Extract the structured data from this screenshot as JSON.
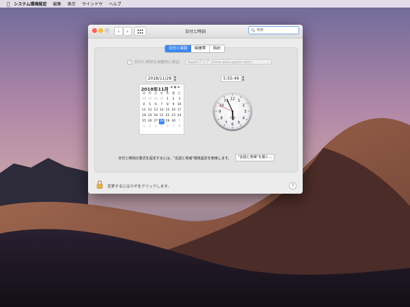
{
  "menubar": {
    "apple_icon": "apple-logo-icon",
    "app_name": "システム環境設定",
    "items": [
      "編集",
      "表示",
      "ウインドウ",
      "ヘルプ"
    ]
  },
  "window": {
    "title": "日付と時刻",
    "search_placeholder": "検索",
    "nav_back": "‹",
    "nav_forward": "›",
    "grid_icon": "grid-icon"
  },
  "tabs": [
    {
      "label": "日付と時刻",
      "active": true
    },
    {
      "label": "時間帯",
      "active": false
    },
    {
      "label": "時計",
      "active": false
    }
  ],
  "auto": {
    "label": "日付と時刻を自動的に設定:",
    "checked": true,
    "server": "Appleアジア (time.asia.apple.com)"
  },
  "date_field": "2018/11/28",
  "time_field": "5:55:49",
  "calendar": {
    "month": "2018年11月",
    "nav": [
      "◀",
      "●",
      "▶"
    ],
    "weekdays": [
      "日",
      "月",
      "火",
      "水",
      "木",
      "金",
      "土"
    ],
    "weeks": [
      [
        "28",
        "29",
        "30",
        "31",
        "1",
        "2",
        "3"
      ],
      [
        "4",
        "5",
        "6",
        "7",
        "8",
        "9",
        "10"
      ],
      [
        "11",
        "12",
        "13",
        "14",
        "15",
        "16",
        "17"
      ],
      [
        "18",
        "19",
        "20",
        "21",
        "22",
        "23",
        "24"
      ],
      [
        "25",
        "26",
        "27",
        "28",
        "29",
        "30",
        "1"
      ],
      [
        "2",
        "3",
        "4",
        "5",
        "6",
        "7",
        "8"
      ]
    ],
    "selected": "28"
  },
  "clock": {
    "numbers": [
      "12",
      "1",
      "2",
      "3",
      "4",
      "5",
      "6",
      "7",
      "8",
      "9",
      "10",
      "11"
    ],
    "ampm": "午前",
    "hour": 5,
    "minute": 55,
    "second": 49
  },
  "footer": {
    "note": "日付と時刻の書式を設定するには、\"言語と地域\"環境設定を使用します。",
    "open_button": "\"言語と地域\"を開く...",
    "lock_text": "変更するにはカギをクリックします。",
    "help": "?"
  },
  "colors": {
    "accent": "#3d86f0",
    "close": "#fe5f57",
    "minimize": "#febc2e",
    "zoom": "#cfcfcf"
  }
}
